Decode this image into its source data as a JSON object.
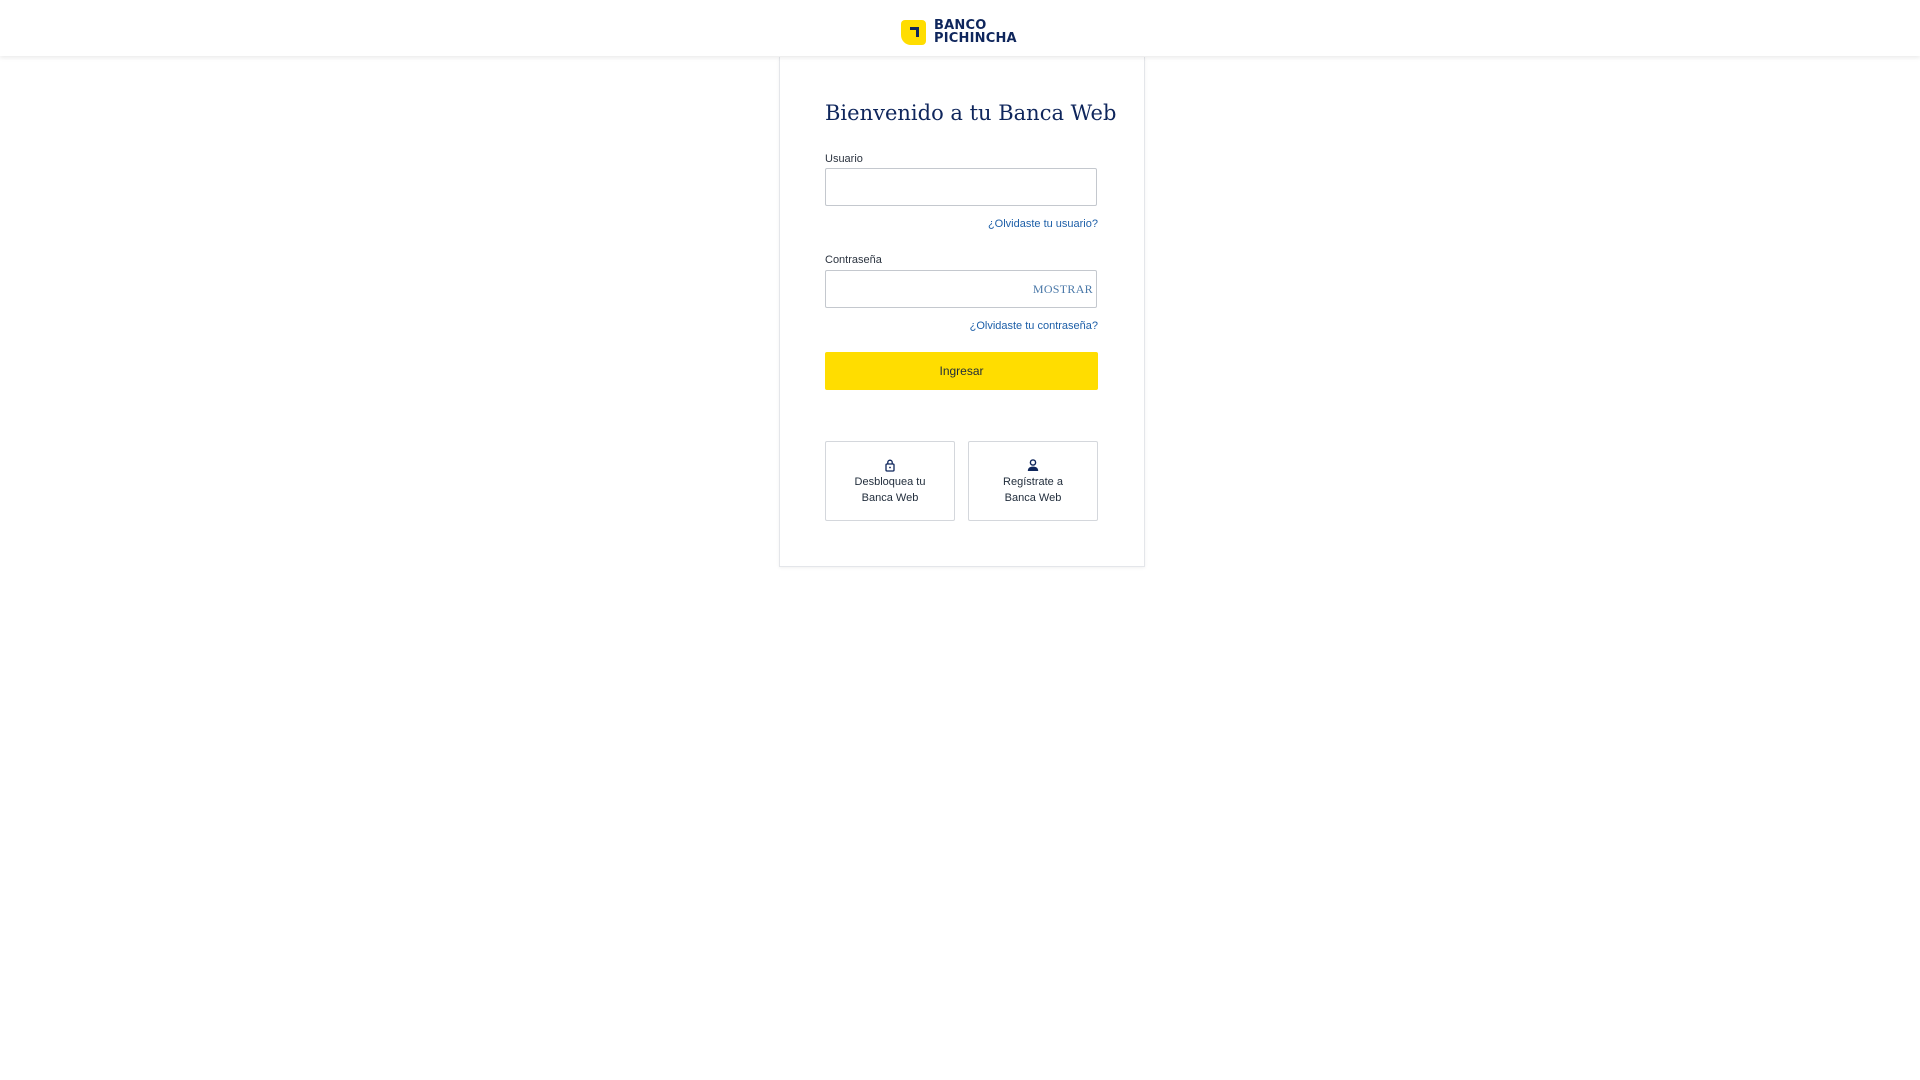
{
  "header": {
    "logo_line1": "BANCO",
    "logo_line2": "PICHINCHA"
  },
  "login": {
    "title": "Bienvenido a tu Banca Web",
    "user_label": "Usuario",
    "user_value": "",
    "forgot_user": "¿Olvidaste tu usuario?",
    "password_label": "Contraseña",
    "password_value": "",
    "show_password": "MOSTRAR",
    "forgot_password": "¿Olvidaste tu contraseña?",
    "submit": "Ingresar"
  },
  "actions": [
    {
      "label": "Desbloquea tu Banca Web",
      "icon": "lock-icon"
    },
    {
      "label": "Regístrate a Banca Web",
      "icon": "user-icon"
    }
  ],
  "colors": {
    "brand_yellow": "#ffdd00",
    "brand_navy": "#0f265c",
    "link_blue": "#1d5fa8"
  }
}
